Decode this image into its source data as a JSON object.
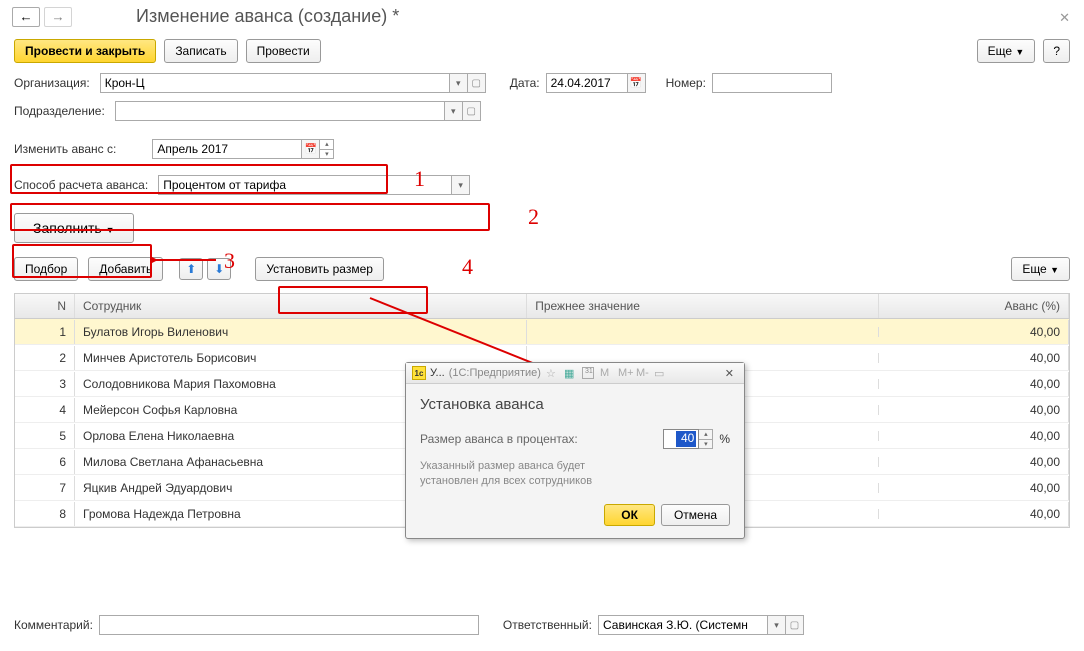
{
  "nav": {
    "back": "←",
    "forward": "→"
  },
  "title": "Изменение аванса (создание) *",
  "toolbar": {
    "postClose": "Провести и закрыть",
    "write": "Записать",
    "post": "Провести",
    "more": "Еще",
    "help": "?"
  },
  "fields": {
    "orgLabel": "Организация:",
    "orgValue": "Крон-Ц",
    "dateLabel": "Дата:",
    "dateValue": "24.04.2017",
    "numberLabel": "Номер:",
    "numberValue": "",
    "divisionLabel": "Подразделение:",
    "changeFromLabel": "Изменить аванс с:",
    "changeFromValue": "Апрель 2017",
    "methodLabel": "Способ расчета аванса:",
    "methodValue": "Процентом от тарифа"
  },
  "actions": {
    "fill": "Заполнить",
    "select": "Подбор",
    "add": "Добавить",
    "setSize": "Установить размер",
    "more2": "Еще"
  },
  "table": {
    "headers": {
      "n": "N",
      "emp": "Сотрудник",
      "prev": "Прежнее значение",
      "av": "Аванс (%)"
    },
    "rows": [
      {
        "n": "1",
        "emp": "Булатов Игорь Виленович",
        "av": "40,00"
      },
      {
        "n": "2",
        "emp": "Минчев Аристотель Борисович",
        "av": "40,00"
      },
      {
        "n": "3",
        "emp": "Солодовникова Мария Пахомовна",
        "av": "40,00"
      },
      {
        "n": "4",
        "emp": "Мейерсон Софья Карловна",
        "av": "40,00"
      },
      {
        "n": "5",
        "emp": "Орлова Елена Николаевна",
        "av": "40,00"
      },
      {
        "n": "6",
        "emp": "Милова Светлана Афанасьевна",
        "av": "40,00"
      },
      {
        "n": "7",
        "emp": "Яцкив Андрей Эдуардович",
        "av": "40,00"
      },
      {
        "n": "8",
        "emp": "Громова Надежда Петровна",
        "av": "40,00"
      }
    ]
  },
  "bottom": {
    "commentLabel": "Комментарий:",
    "respLabel": "Ответственный:",
    "respValue": "Савинская З.Ю. (Системн"
  },
  "dialog": {
    "captionShort": "У...",
    "caption1c": "(1С:Предприятие)",
    "heading": "Установка аванса",
    "sizeLabel": "Размер аванса в процентах:",
    "sizeValue": "40",
    "pct": "%",
    "hint1": "Указанный размер аванса будет",
    "hint2": "установлен для всех сотрудников",
    "ok": "ОК",
    "cancel": "Отмена"
  },
  "anno": {
    "one": "1",
    "two": "2",
    "three": "3",
    "four": "4"
  }
}
